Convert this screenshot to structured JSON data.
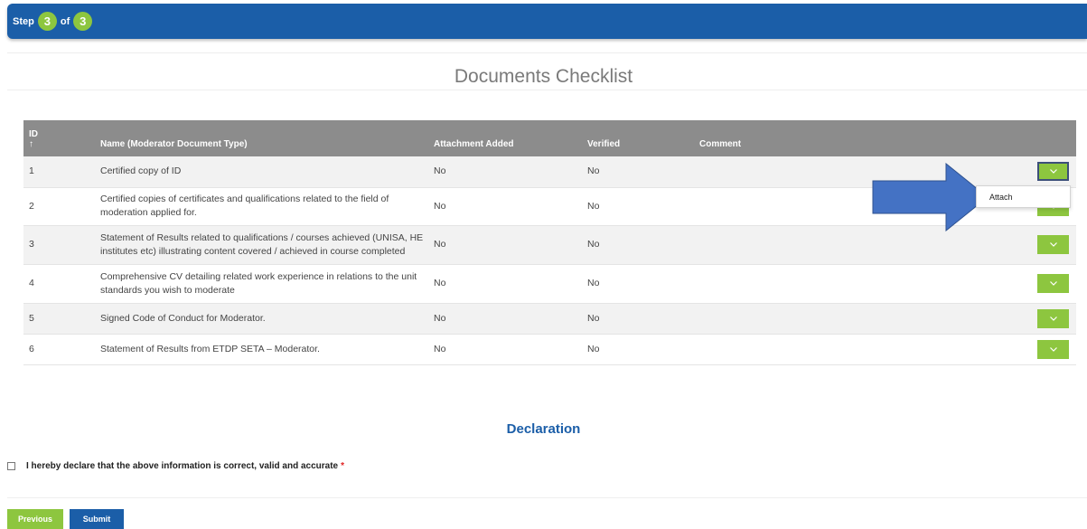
{
  "stepper": {
    "prefix": "Step",
    "current": "3",
    "of_label": "of",
    "total": "3"
  },
  "page_title": "Documents Checklist",
  "table": {
    "headers": {
      "id": "ID",
      "sort_indicator": "↑",
      "name": "Name (Moderator Document Type)",
      "attachment": "Attachment Added",
      "verified": "Verified",
      "comment": "Comment"
    },
    "rows": [
      {
        "id": "1",
        "name": "Certified copy of ID",
        "attachment": "No",
        "verified": "No",
        "comment": ""
      },
      {
        "id": "2",
        "name": "Certified copies of certificates and qualifications related to the field of moderation applied for.",
        "attachment": "No",
        "verified": "No",
        "comment": ""
      },
      {
        "id": "3",
        "name": "Statement of Results related to qualifications / courses achieved (UNISA, HE institutes etc) illustrating content covered / achieved in course completed",
        "attachment": "No",
        "verified": "No",
        "comment": ""
      },
      {
        "id": "4",
        "name": "Comprehensive CV detailing related work experience in relations to the unit standards you wish to moderate",
        "attachment": "No",
        "verified": "No",
        "comment": ""
      },
      {
        "id": "5",
        "name": "Signed Code of Conduct for Moderator.",
        "attachment": "No",
        "verified": "No",
        "comment": ""
      },
      {
        "id": "6",
        "name": "Statement of Results from ETDP SETA – Moderator.",
        "attachment": "No",
        "verified": "No",
        "comment": ""
      }
    ],
    "action_icon": "chevron-down-icon"
  },
  "dropdown_menu": {
    "items": [
      "Attach"
    ]
  },
  "declaration": {
    "heading": "Declaration",
    "checkbox_label": "I hereby declare that the above information is correct, valid and accurate",
    "required_mark": "*"
  },
  "buttons": {
    "previous": "Previous",
    "submit": "Submit"
  },
  "colors": {
    "primary_blue": "#1b5ea8",
    "accent_green": "#8dc63f",
    "header_gray": "#8c8c8c",
    "annotation_arrow": "#4472c4"
  }
}
